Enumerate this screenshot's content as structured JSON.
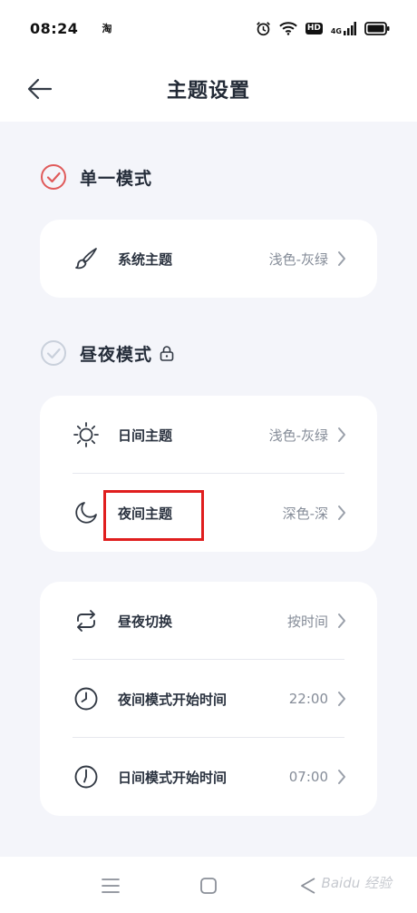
{
  "status_bar": {
    "time": "08:24",
    "app_icon": "淘",
    "network": "4G",
    "hd": "HD"
  },
  "header": {
    "title": "主题设置"
  },
  "single_mode": {
    "label": "单一模式",
    "checked": true,
    "rows": [
      {
        "icon": "brush-icon",
        "label": "系统主题",
        "value": "浅色-灰绿"
      }
    ]
  },
  "day_night_mode": {
    "label": "昼夜模式",
    "checked": false,
    "locked": true,
    "rows": [
      {
        "icon": "sun-icon",
        "label": "日间主题",
        "value": "浅色-灰绿"
      },
      {
        "icon": "moon-icon",
        "label": "夜间主题",
        "value": "深色-深"
      }
    ]
  },
  "schedule": {
    "rows": [
      {
        "icon": "switch-icon",
        "label": "昼夜切换",
        "value": "按时间"
      },
      {
        "icon": "clock-icon",
        "label": "夜间模式开始时间",
        "value": "22:00"
      },
      {
        "icon": "clock-icon",
        "label": "日间模式开始时间",
        "value": "07:00"
      }
    ]
  },
  "watermark": "Baidu 经验",
  "colors": {
    "accent": "#e05a5a",
    "highlight": "#e01e1e",
    "background": "#f4f5fa"
  }
}
